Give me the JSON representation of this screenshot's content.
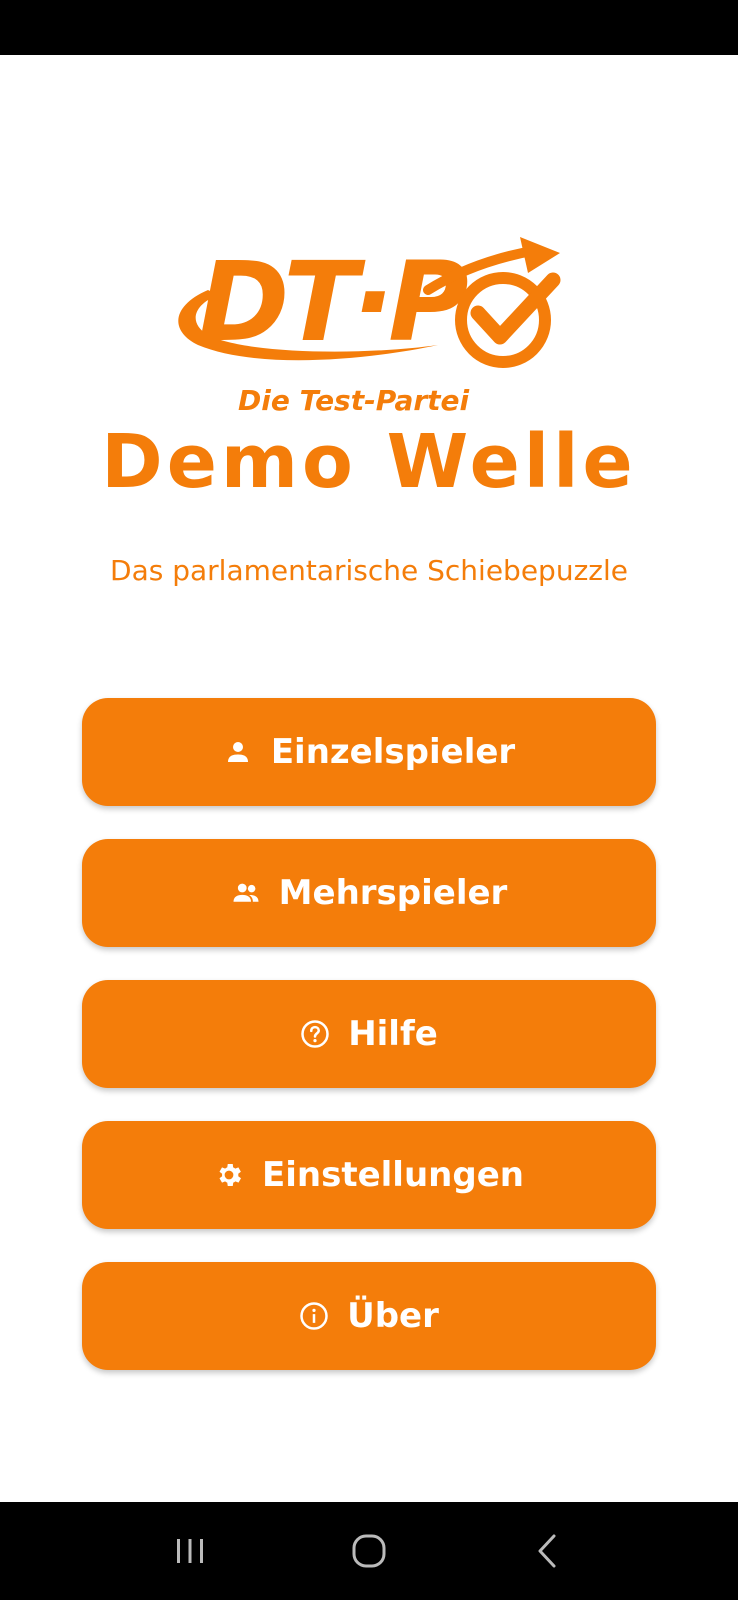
{
  "logo": {
    "letters": "DT·P",
    "tagline": "Die Test-Partei"
  },
  "title": "Demo Welle",
  "subtitle": "Das parlamentarische Schiebepuzzle",
  "menu": [
    {
      "label": "Einzelspieler",
      "icon": "person-icon"
    },
    {
      "label": "Mehrspieler",
      "icon": "people-icon"
    },
    {
      "label": "Hilfe",
      "icon": "help-icon"
    },
    {
      "label": "Einstellungen",
      "icon": "gear-icon"
    },
    {
      "label": "Über",
      "icon": "info-icon"
    }
  ],
  "colors": {
    "accent": "#F47D0A",
    "background": "#FFFFFF",
    "system_bars": "#000000"
  },
  "system_nav": [
    "recent-apps-icon",
    "home-icon",
    "back-icon"
  ]
}
